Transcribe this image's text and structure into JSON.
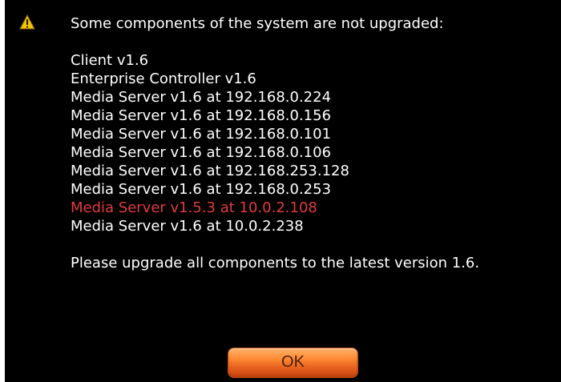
{
  "dialog": {
    "header": "Some components of the system are not upgraded:",
    "components": [
      "Client v1.6",
      "Enterprise Controller v1.6",
      "Media Server v1.6 at 192.168.0.224",
      "Media Server v1.6 at 192.168.0.156",
      "Media Server v1.6 at 192.168.0.101",
      "Media Server v1.6 at 192.168.0.106",
      "Media Server v1.6 at 192.168.253.128",
      "Media Server v1.6 at 192.168.0.253",
      "Media Server v1.5.3 at 10.0.2.108",
      "Media Server v1.6 at 10.0.2.238"
    ],
    "footer": "Please upgrade all components to the latest version 1.6.",
    "ok_label": "OK"
  },
  "icons": {
    "warning": "warning-icon"
  },
  "colors": {
    "background": "#000000",
    "text": "#ffffff",
    "outdated_text": "#e23b3b",
    "button": "#ff8a35",
    "warning": "#f2c400"
  }
}
